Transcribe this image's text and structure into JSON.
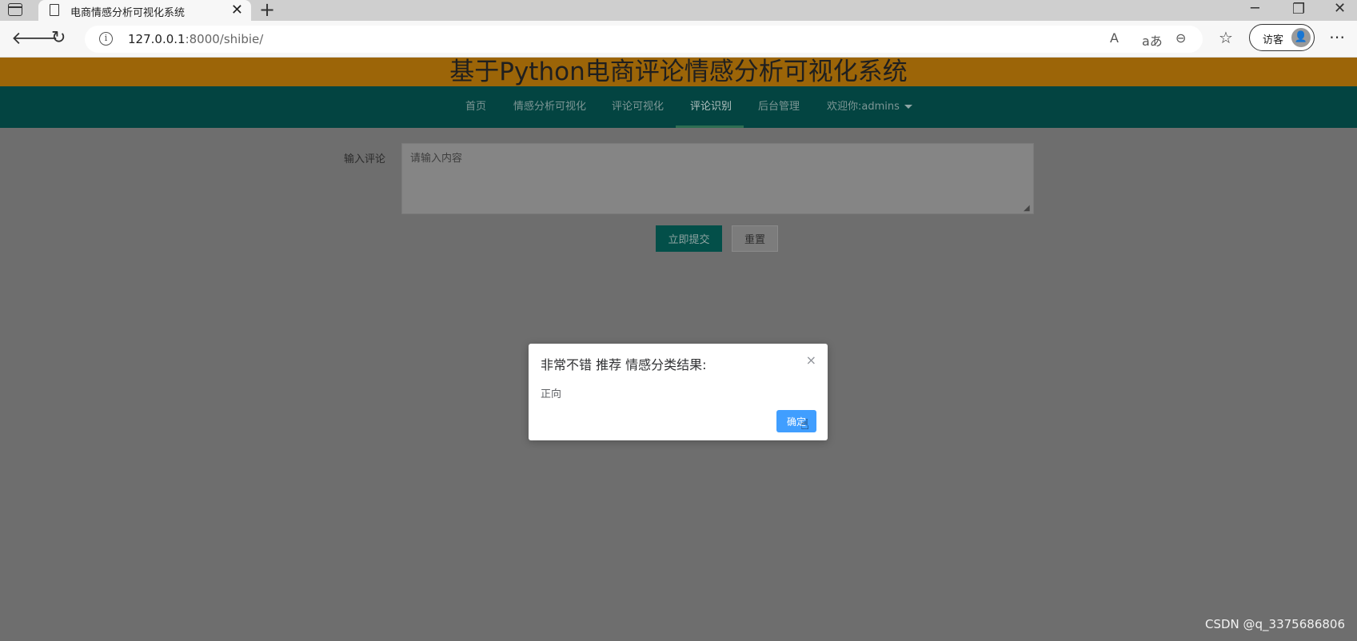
{
  "browser": {
    "tab_title": "电商情感分析可视化系统",
    "tab_close": "✕",
    "new_tab": "+",
    "window": {
      "minimize": "─",
      "restore": "❐",
      "close": "✕"
    },
    "url_host": "127.0.0.1",
    "url_path": ":8000/shibie/",
    "guest_label": "访客",
    "icons": {
      "back": "🡐",
      "refresh": "↻",
      "info": "i",
      "read_aloud": "A",
      "translate": "aあ",
      "zoom": "⊖",
      "favorites": "☆",
      "more": "⋯",
      "guest_avatar": "👤"
    }
  },
  "page": {
    "title": "基于Python电商评论情感分析可视化系统",
    "nav": [
      {
        "label": "首页",
        "active": false
      },
      {
        "label": "情感分析可视化",
        "active": false
      },
      {
        "label": "评论可视化",
        "active": false
      },
      {
        "label": "评论识别",
        "active": true
      },
      {
        "label": "后台管理",
        "active": false
      },
      {
        "label": "欢迎你:admins",
        "active": false
      }
    ],
    "form": {
      "label": "输入评论",
      "placeholder": "请输入内容",
      "submit": "立即提交",
      "reset": "重置"
    }
  },
  "dialog": {
    "title": "非常不错 推荐 情感分类结果:",
    "close": "×",
    "message": "正向",
    "confirm": "确定"
  },
  "watermark": "CSDN @q_3375686806",
  "colors": {
    "banner": "#9c6508",
    "navbar": "#034441",
    "submit_button": "#034f49",
    "confirm_button": "#409eff"
  }
}
